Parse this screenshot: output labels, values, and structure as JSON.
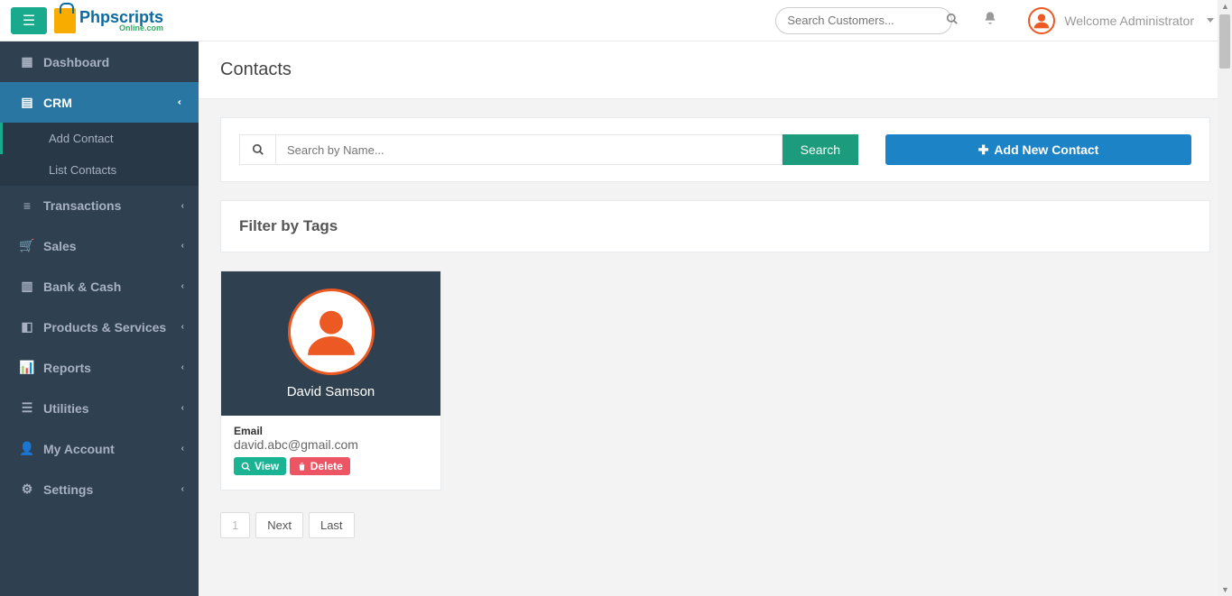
{
  "header": {
    "logo_main": "Phpscripts",
    "logo_sub": "Online.com",
    "search_placeholder": "Search Customers...",
    "welcome": "Welcome Administrator"
  },
  "sidebar": {
    "items": [
      {
        "label": "Dashboard",
        "icon": "grid"
      },
      {
        "label": "CRM",
        "icon": "card",
        "active": true,
        "expanded": true
      },
      {
        "label": "Transactions",
        "icon": "db"
      },
      {
        "label": "Sales",
        "icon": "cart"
      },
      {
        "label": "Bank & Cash",
        "icon": "bank"
      },
      {
        "label": "Products & Services",
        "icon": "cube"
      },
      {
        "label": "Reports",
        "icon": "chart"
      },
      {
        "label": "Utilities",
        "icon": "list"
      },
      {
        "label": "My Account",
        "icon": "user"
      },
      {
        "label": "Settings",
        "icon": "gear"
      }
    ],
    "crm_sub": [
      {
        "label": "Add Contact"
      },
      {
        "label": "List Contacts"
      }
    ]
  },
  "page": {
    "title": "Contacts",
    "search_placeholder": "Search by Name...",
    "search_button": "Search",
    "add_button": "Add New Contact",
    "filter_title": "Filter by Tags"
  },
  "contacts": [
    {
      "name": "David Samson",
      "email_label": "Email",
      "email": "david.abc@gmail.com",
      "view_label": "View",
      "delete_label": "Delete"
    }
  ],
  "pagination": {
    "current": "1",
    "next": "Next",
    "last": "Last"
  }
}
